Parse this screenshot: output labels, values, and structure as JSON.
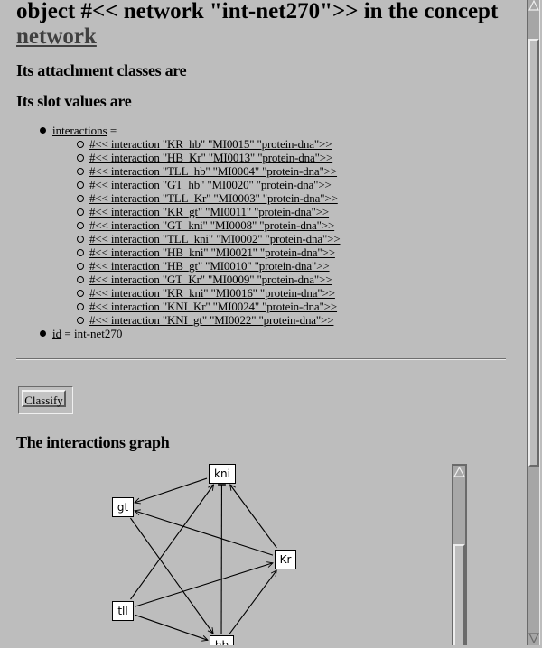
{
  "header": {
    "title": "object #<< network \"int-net270\">> in the concept",
    "concept_link": "network"
  },
  "sections": {
    "attachment_classes": "Its attachment classes are",
    "slot_values": "Its slot values are",
    "graph_heading": "The interactions graph"
  },
  "slots": {
    "interactions": {
      "name": "interactions",
      "separator": " =",
      "values": [
        "#<< interaction \"KR_hb\" \"MI0015\" \"protein-dna\">>",
        "#<< interaction \"HB_Kr\" \"MI0013\" \"protein-dna\">>",
        "#<< interaction \"TLL_hb\" \"MI0004\" \"protein-dna\">>",
        "#<< interaction \"GT_hb\" \"MI0020\" \"protein-dna\">>",
        "#<< interaction \"TLL_Kr\" \"MI0003\" \"protein-dna\">>",
        "#<< interaction \"KR_gt\" \"MI0011\" \"protein-dna\">>",
        "#<< interaction \"GT_kni\" \"MI0008\" \"protein-dna\">>",
        "#<< interaction \"TLL_kni\" \"MI0002\" \"protein-dna\">>",
        "#<< interaction \"HB_kni\" \"MI0021\" \"protein-dna\">>",
        "#<< interaction \"HB_gt\" \"MI0010\" \"protein-dna\">>",
        "#<< interaction \"GT_Kr\" \"MI0009\" \"protein-dna\">>",
        "#<< interaction \"KR_kni\" \"MI0016\" \"protein-dna\">>",
        "#<< interaction \"KNI_Kr\" \"MI0024\" \"protein-dna\">>",
        "#<< interaction \"KNI_gt\" \"MI0022\" \"protein-dna\">>"
      ]
    },
    "id": {
      "name": "id",
      "value": " = int-net270"
    }
  },
  "actions": {
    "classify_label": "Classify"
  },
  "graph": {
    "nodes": [
      {
        "id": "kni",
        "label": "kni"
      },
      {
        "id": "gt",
        "label": "gt"
      },
      {
        "id": "Kr",
        "label": "Kr"
      },
      {
        "id": "tll",
        "label": "tll"
      },
      {
        "id": "hb",
        "label": "hb"
      }
    ],
    "edges": [
      {
        "from": "kni",
        "to": "gt",
        "type": "arrow"
      },
      {
        "from": "Kr",
        "to": "gt",
        "type": "arrow"
      },
      {
        "from": "tll",
        "to": "kni",
        "type": "arrow"
      },
      {
        "from": "hb",
        "to": "kni",
        "type": "bar"
      },
      {
        "from": "Kr",
        "to": "kni",
        "type": "arrow"
      },
      {
        "from": "gt",
        "to": "hb",
        "type": "arrow"
      },
      {
        "from": "tll",
        "to": "Kr",
        "type": "arrow"
      },
      {
        "from": "tll",
        "to": "hb",
        "type": "arrow"
      },
      {
        "from": "hb",
        "to": "Kr",
        "type": "arrow"
      }
    ]
  }
}
